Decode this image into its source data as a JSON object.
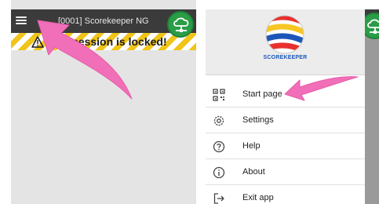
{
  "colors": {
    "topbar": "#3b3b3b",
    "cloud_button": "#2a9d46",
    "warning_stripe": "#f0c418",
    "arrow": "#f06fb8",
    "logo_text": "#1c56b8"
  },
  "left_screen": {
    "topbar": {
      "menu_icon": "hamburger-menu-icon",
      "title": "[0001] Scorekeeper NG",
      "cloud_icon": "cloud-network-icon"
    },
    "locked_banner": {
      "icon": "warning-triangle-icon",
      "text": "session is locked!"
    }
  },
  "right_screen": {
    "drawer": {
      "logo_text": "SCOREKEEPER",
      "items": [
        {
          "label": "Start page",
          "icon": "qr-code-icon"
        },
        {
          "label": "Settings",
          "icon": "gear-icon"
        },
        {
          "label": "Help",
          "icon": "help-circle-icon"
        },
        {
          "label": "About",
          "icon": "info-circle-icon"
        },
        {
          "label": "Exit app",
          "icon": "exit-icon"
        }
      ]
    }
  }
}
